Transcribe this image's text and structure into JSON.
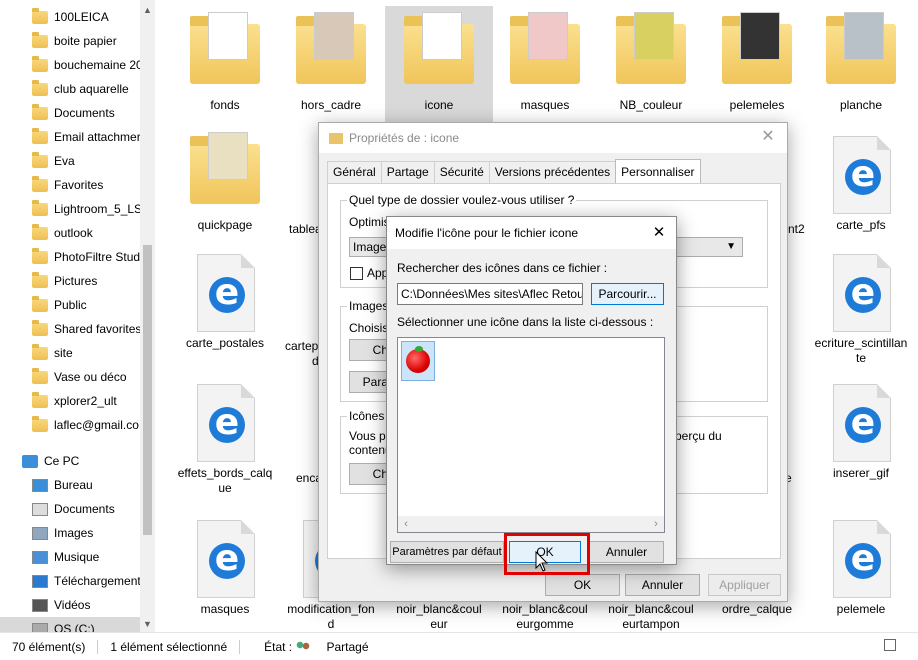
{
  "sidebar": {
    "items": [
      {
        "label": "100LEICA",
        "icon": "folder-icon"
      },
      {
        "label": "boite papier",
        "icon": "folder-icon"
      },
      {
        "label": "bouchemaine 20",
        "icon": "folder-icon"
      },
      {
        "label": "club aquarelle",
        "icon": "folder-icon"
      },
      {
        "label": "Documents",
        "icon": "folder-icon"
      },
      {
        "label": "Email attachmer",
        "icon": "folder-icon"
      },
      {
        "label": "Eva",
        "icon": "folder-icon"
      },
      {
        "label": "Favorites",
        "icon": "folder-icon"
      },
      {
        "label": "Lightroom_5_LS",
        "icon": "folder-icon"
      },
      {
        "label": "outlook",
        "icon": "folder-icon"
      },
      {
        "label": "PhotoFiltre Stud",
        "icon": "folder-icon"
      },
      {
        "label": "Pictures",
        "icon": "folder-icon"
      },
      {
        "label": "Public",
        "icon": "folder-icon"
      },
      {
        "label": "Shared favorites",
        "icon": "folder-icon"
      },
      {
        "label": "site",
        "icon": "folder-icon"
      },
      {
        "label": "Vase ou déco",
        "icon": "folder-icon"
      },
      {
        "label": "xplorer2_ult",
        "icon": "folder-icon"
      },
      {
        "label": "laflec@gmail.co",
        "icon": "folder-icon"
      }
    ],
    "pc": {
      "label": "Ce PC",
      "icon": "computer-icon"
    },
    "pc_items": [
      {
        "label": "Bureau",
        "icon": "desktop-icon"
      },
      {
        "label": "Documents",
        "icon": "documents-icon"
      },
      {
        "label": "Images",
        "icon": "images-icon"
      },
      {
        "label": "Musique",
        "icon": "music-icon"
      },
      {
        "label": "Téléchargement",
        "icon": "download-icon"
      },
      {
        "label": "Vidéos",
        "icon": "video-icon"
      },
      {
        "label": "OS (C:)",
        "icon": "drive-icon"
      }
    ]
  },
  "files": {
    "row1": [
      "fonds",
      "hors_cadre",
      "icone",
      "masques",
      "NB_couleur",
      "pelemeles",
      "planche"
    ],
    "row2": [
      "quickpage",
      "tablea",
      "nt2",
      "carte_pfs"
    ],
    "row3": [
      "carte_postales",
      "cartep",
      "d",
      "ecriture_scintillan",
      "te"
    ],
    "row4": [
      "effets_bords_calq",
      "ue",
      "enca",
      "e",
      "inserer_gif"
    ],
    "row5": [
      [
        "masques",
        ""
      ],
      [
        "modification_fon",
        "d"
      ],
      [
        "noir_blanc&coul",
        "eur"
      ],
      [
        "noir_blanc&coul",
        "eurgomme"
      ],
      [
        "noir_blanc&coul",
        "eurtampon"
      ],
      [
        "ordre_calque",
        ""
      ],
      [
        "pelemele",
        ""
      ]
    ]
  },
  "status": {
    "count": "70 élément(s)",
    "selected": "1 élément sélectionné",
    "state_label": "État :",
    "state_value": "Partagé"
  },
  "properties": {
    "title": "Propriétés de : icone",
    "tabs": [
      "Général",
      "Partage",
      "Sécurité",
      "Versions précédentes",
      "Personnaliser"
    ],
    "group1_title": "Quel type de dossier voulez-vous utiliser ?",
    "optimize_label": "Optimise",
    "combo_value": "Images",
    "apply_label": "Appl",
    "group2_title": "Images",
    "choose_label": "Choisiss",
    "btn_ch": "Ch",
    "btn_para": "Para",
    "group3_title": "Icônes c",
    "vous_po": "Vous po",
    "contenu": "contenu",
    "apercu": "perçu du",
    "btn_ch2": "Ch",
    "ok": "OK",
    "cancel": "Annuler",
    "apply": "Appliquer"
  },
  "change_icon": {
    "title": "Modifie l'icône pour le fichier icone",
    "search_label": "Rechercher des icônes dans ce fichier :",
    "path_value": "C:\\Données\\Mes sites\\Aflec Retouch",
    "browse": "Parcourir...",
    "select_label": "Sélectionner une icône dans la liste ci-dessous :",
    "defaults": "Paramètres par défaut",
    "ok": "OK",
    "cancel": "Annuler"
  }
}
